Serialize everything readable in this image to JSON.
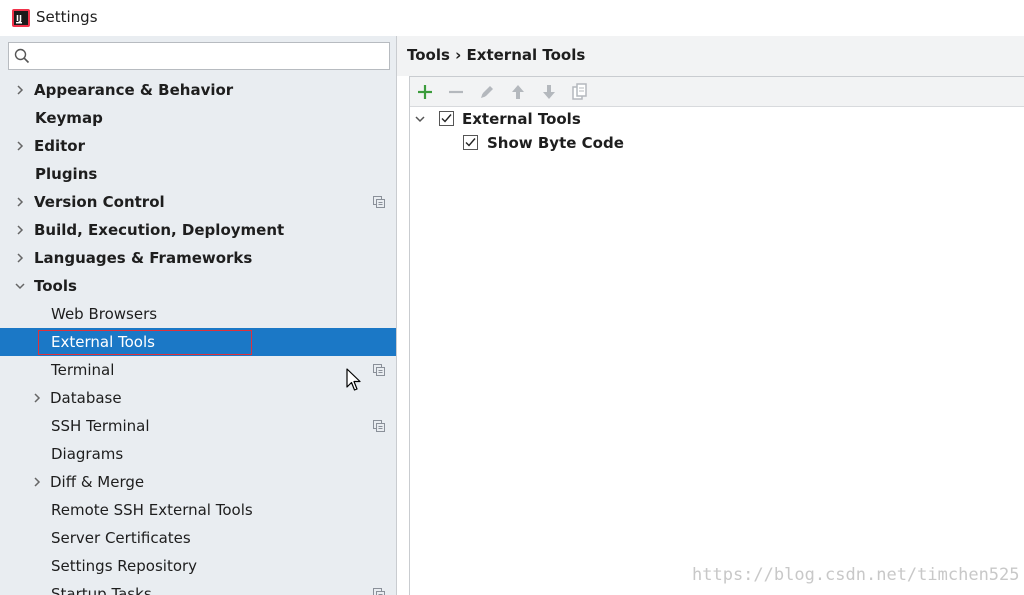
{
  "window": {
    "title": "Settings"
  },
  "search": {
    "value": "",
    "placeholder": ""
  },
  "sidebar": {
    "items": [
      {
        "label": "Appearance & Behavior",
        "expandable": true,
        "expanded": false,
        "level": 0,
        "bold": true
      },
      {
        "label": "Keymap",
        "expandable": false,
        "level": 0,
        "bold": true
      },
      {
        "label": "Editor",
        "expandable": true,
        "expanded": false,
        "level": 0,
        "bold": true
      },
      {
        "label": "Plugins",
        "expandable": false,
        "level": 0,
        "bold": true
      },
      {
        "label": "Version Control",
        "expandable": true,
        "expanded": false,
        "level": 0,
        "bold": true,
        "project_icon": true
      },
      {
        "label": "Build, Execution, Deployment",
        "expandable": true,
        "expanded": false,
        "level": 0,
        "bold": true
      },
      {
        "label": "Languages & Frameworks",
        "expandable": true,
        "expanded": false,
        "level": 0,
        "bold": true
      },
      {
        "label": "Tools",
        "expandable": true,
        "expanded": true,
        "level": 0,
        "bold": true
      },
      {
        "label": "Web Browsers",
        "expandable": false,
        "level": 1
      },
      {
        "label": "External Tools",
        "expandable": false,
        "level": 1,
        "selected": true
      },
      {
        "label": "Terminal",
        "expandable": false,
        "level": 1,
        "project_icon": true
      },
      {
        "label": "Database",
        "expandable": true,
        "expanded": false,
        "level": 1
      },
      {
        "label": "SSH Terminal",
        "expandable": false,
        "level": 1,
        "project_icon": true
      },
      {
        "label": "Diagrams",
        "expandable": false,
        "level": 1
      },
      {
        "label": "Diff & Merge",
        "expandable": true,
        "expanded": false,
        "level": 1
      },
      {
        "label": "Remote SSH External Tools",
        "expandable": false,
        "level": 1
      },
      {
        "label": "Server Certificates",
        "expandable": false,
        "level": 1
      },
      {
        "label": "Settings Repository",
        "expandable": false,
        "level": 1
      },
      {
        "label": "Startup Tasks",
        "expandable": false,
        "level": 1,
        "project_icon": true
      }
    ]
  },
  "main": {
    "breadcrumb": "Tools › External Tools",
    "toolbar": {
      "buttons": [
        {
          "icon": "add-icon",
          "enabled": true
        },
        {
          "icon": "remove-icon",
          "enabled": false
        },
        {
          "icon": "edit-icon",
          "enabled": false
        },
        {
          "icon": "move-up-icon",
          "enabled": false
        },
        {
          "icon": "move-down-icon",
          "enabled": false
        },
        {
          "icon": "copy-icon",
          "enabled": false
        }
      ]
    },
    "tools_tree": {
      "group": {
        "label": "External Tools",
        "checked": true,
        "expanded": true
      },
      "items": [
        {
          "label": "Show Byte Code",
          "checked": true
        }
      ]
    }
  },
  "colors": {
    "selection": "#1b78c6",
    "sidebar_bg": "#e9edf1",
    "add_green": "#3c9c3c",
    "highlight_border": "#e0323a"
  },
  "watermark": "https://blog.csdn.net/timchen525"
}
